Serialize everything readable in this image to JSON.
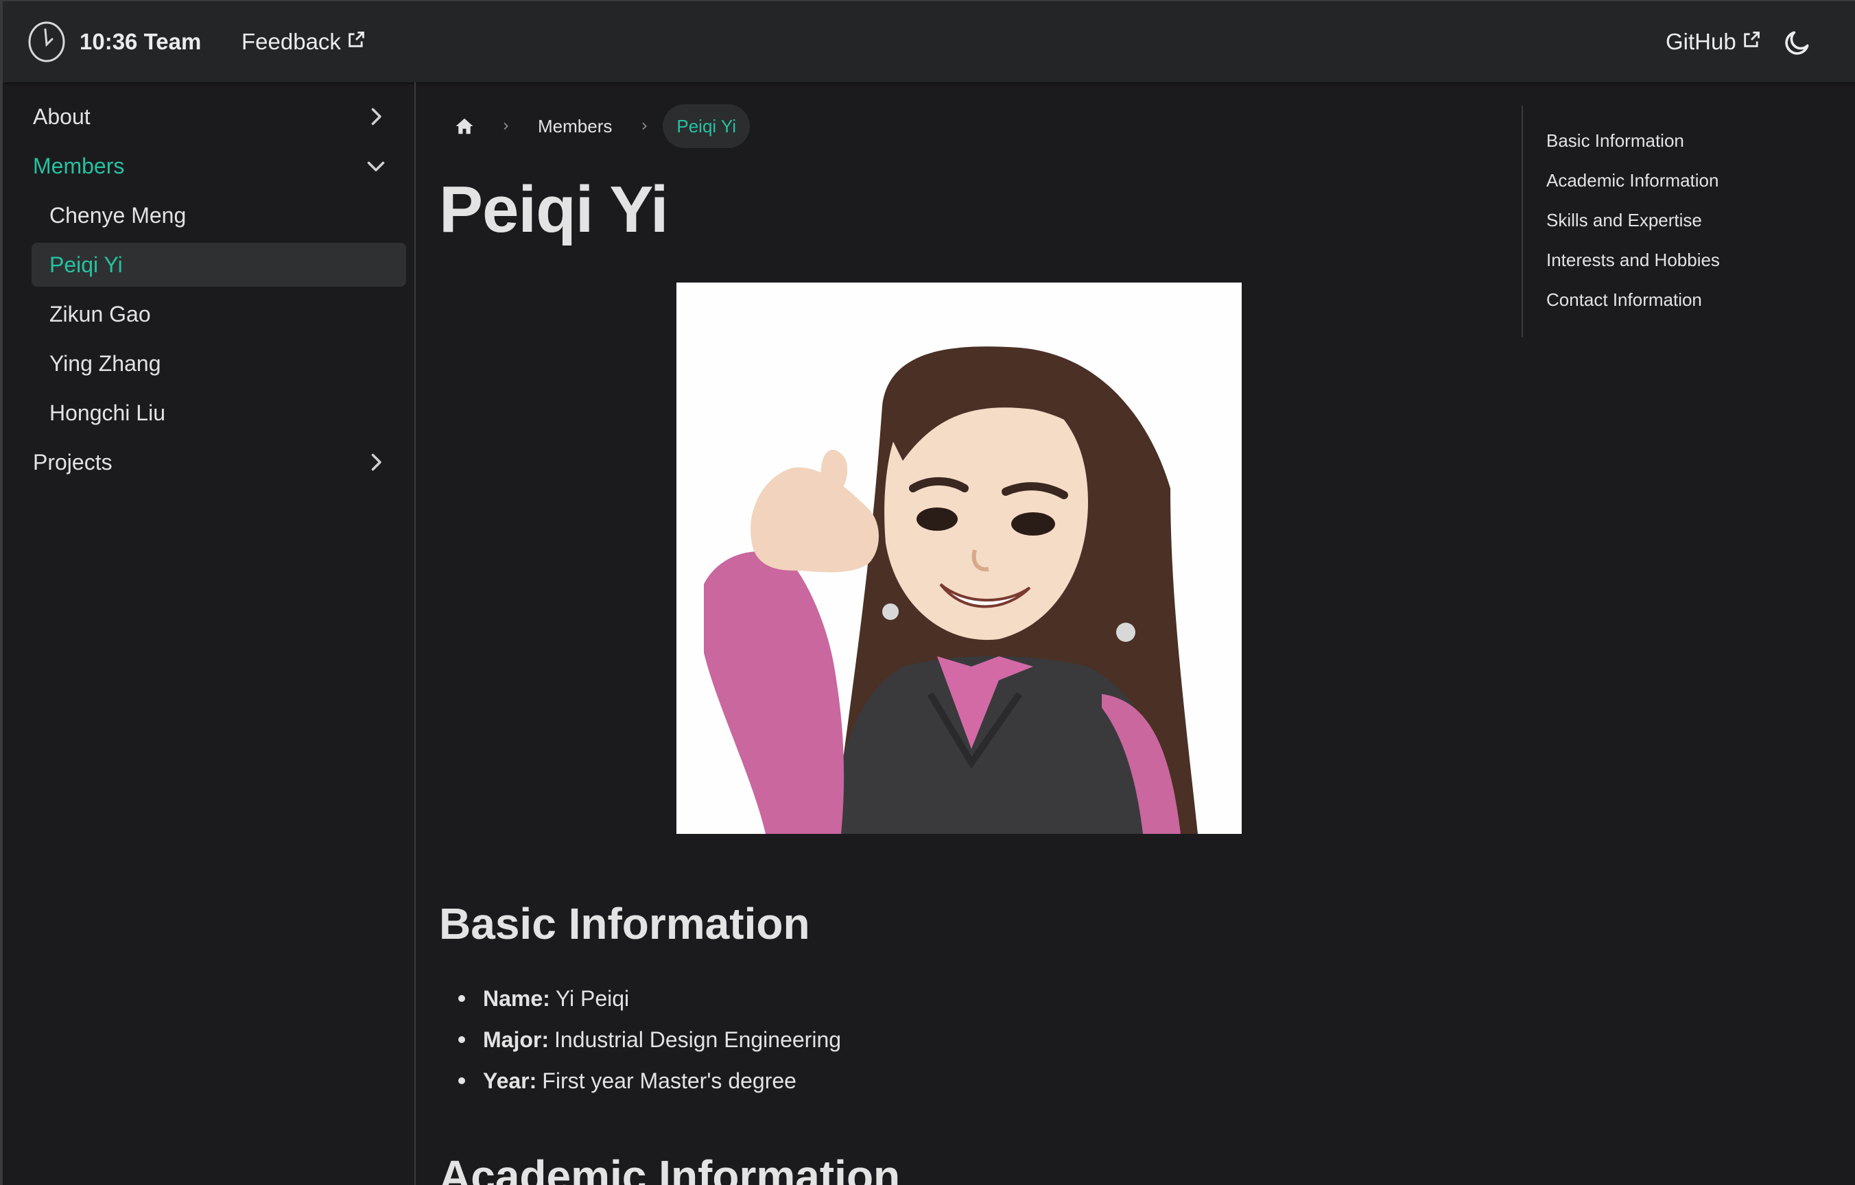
{
  "navbar": {
    "brand_title": "10:36 Team",
    "feedback_label": "Feedback",
    "github_label": "GitHub",
    "theme_icon": "moon-icon"
  },
  "sidebar": {
    "items": [
      {
        "label": "About",
        "expanded": false
      },
      {
        "label": "Members",
        "expanded": true,
        "active": true
      },
      {
        "label": "Chenye Meng"
      },
      {
        "label": "Peiqi Yi",
        "selected": true
      },
      {
        "label": "Zikun Gao"
      },
      {
        "label": "Ying Zhang"
      },
      {
        "label": "Hongchi Liu"
      },
      {
        "label": "Projects",
        "expanded": false
      }
    ]
  },
  "breadcrumb": {
    "home_icon": "home-icon",
    "items": [
      "Members",
      "Peiqi Yi"
    ]
  },
  "page": {
    "title": "Peiqi Yi",
    "sections": {
      "basic": {
        "heading": "Basic Information",
        "items": [
          {
            "key": "Name:",
            "value": "Yi Peiqi"
          },
          {
            "key": "Major:",
            "value": "Industrial Design Engineering"
          },
          {
            "key": "Year:",
            "value": "First year Master's degree"
          }
        ]
      },
      "academic": {
        "heading": "Academic Information"
      }
    }
  },
  "toc": {
    "items": [
      "Basic Information",
      "Academic Information",
      "Skills and Expertise",
      "Interests and Hobbies",
      "Contact Information"
    ]
  },
  "colors": {
    "accent": "#25c2a0",
    "background": "#1b1b1d",
    "navbar": "#242526"
  }
}
